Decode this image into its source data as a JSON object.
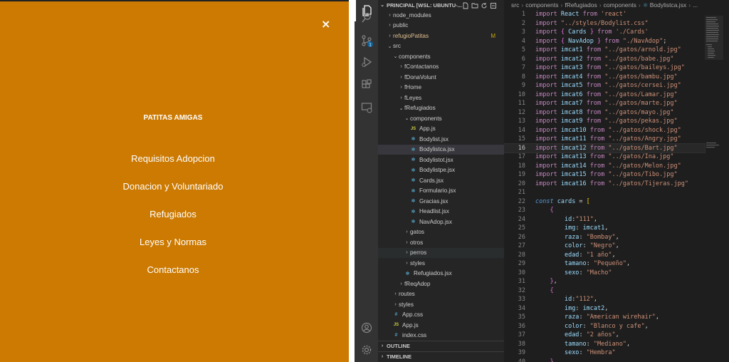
{
  "left_panel": {
    "close_icon": "×",
    "brand": "PATITAS AMIGAS",
    "menu": [
      "Requisitos Adopcion",
      "Donacion y Voluntariado",
      "Refugiados",
      "Leyes y Normas",
      "Contactanos"
    ],
    "background": "#cc7a02"
  },
  "activity_bar": {
    "icons": [
      "files-icon",
      "search-icon",
      "source-control-icon",
      "run-debug-icon",
      "extensions-icon",
      "remote-explorer-icon",
      "account-icon",
      "settings-gear-icon"
    ],
    "source_control_badge": "1"
  },
  "explorer": {
    "title": "PRINCIPAL [WSL: UBUNTU-...",
    "tree": [
      {
        "label": "node_modules",
        "depth": 1,
        "kind": "folder",
        "open": false
      },
      {
        "label": "public",
        "depth": 1,
        "kind": "folder",
        "open": false
      },
      {
        "label": "refugioPatitas",
        "depth": 1,
        "kind": "folder",
        "open": false,
        "git": "M",
        "color": "#e2c08d"
      },
      {
        "label": "src",
        "depth": 1,
        "kind": "folder",
        "open": true
      },
      {
        "label": "components",
        "depth": 2,
        "kind": "folder",
        "open": true
      },
      {
        "label": "fContactanos",
        "depth": 3,
        "kind": "folder",
        "open": false
      },
      {
        "label": "fDonaVolunt",
        "depth": 3,
        "kind": "folder",
        "open": false
      },
      {
        "label": "fHome",
        "depth": 3,
        "kind": "folder",
        "open": false
      },
      {
        "label": "fLeyes",
        "depth": 3,
        "kind": "folder",
        "open": false
      },
      {
        "label": "fRefugiados",
        "depth": 3,
        "kind": "folder",
        "open": true
      },
      {
        "label": "components",
        "depth": 4,
        "kind": "folder",
        "open": true
      },
      {
        "label": "App.js",
        "depth": 5,
        "kind": "js"
      },
      {
        "label": "Bodylist.jsx",
        "depth": 5,
        "kind": "jsx"
      },
      {
        "label": "Bodylistca.jsx",
        "depth": 5,
        "kind": "jsx",
        "selected": true
      },
      {
        "label": "Bodylistot.jsx",
        "depth": 5,
        "kind": "jsx"
      },
      {
        "label": "Bodylistpe.jsx",
        "depth": 5,
        "kind": "jsx"
      },
      {
        "label": "Cards.jsx",
        "depth": 5,
        "kind": "jsx"
      },
      {
        "label": "Formulario.jsx",
        "depth": 5,
        "kind": "jsx"
      },
      {
        "label": "Gracias.jsx",
        "depth": 5,
        "kind": "jsx"
      },
      {
        "label": "Headlist.jsx",
        "depth": 5,
        "kind": "jsx"
      },
      {
        "label": "NavAdop.jsx",
        "depth": 5,
        "kind": "jsx"
      },
      {
        "label": "gatos",
        "depth": 4,
        "kind": "folder",
        "open": false
      },
      {
        "label": "otros",
        "depth": 4,
        "kind": "folder",
        "open": false
      },
      {
        "label": "perros",
        "depth": 4,
        "kind": "folder",
        "open": false,
        "hover": true
      },
      {
        "label": "styles",
        "depth": 4,
        "kind": "folder",
        "open": false
      },
      {
        "label": "Refugiados.jsx",
        "depth": 4,
        "kind": "jsx"
      },
      {
        "label": "fReqAdop",
        "depth": 3,
        "kind": "folder",
        "open": false
      },
      {
        "label": "routes",
        "depth": 2,
        "kind": "folder",
        "open": false
      },
      {
        "label": "styles",
        "depth": 2,
        "kind": "folder",
        "open": false
      },
      {
        "label": "App.css",
        "depth": 2,
        "kind": "css"
      },
      {
        "label": "App.js",
        "depth": 2,
        "kind": "js"
      },
      {
        "label": "index.css",
        "depth": 2,
        "kind": "css"
      }
    ],
    "outline": "OUTLINE",
    "timeline": "TIMELINE"
  },
  "editor": {
    "breadcrumbs": [
      "src",
      "components",
      "fRefugiados",
      "components",
      "Bodylistca.jsx",
      "..."
    ],
    "current_line": 16,
    "lines": [
      "import React from 'react'",
      "import \"../styles/Bodylist.css\"",
      "import { Cards } from './Cards'",
      "import { NavAdop } from \"./NavAdop\";",
      "import imcat1 from \"../gatos/arnold.jpg\"",
      "import imcat2 from \"../gatos/babe.jpg\"",
      "import imcat3 from \"../gatos/baileys.jpg\"",
      "import imcat4 from \"../gatos/bambu.jpg\"",
      "import imcat5 from \"../gatos/cersei.jpg\"",
      "import imcat6 from \"../gatos/Lamar.jpg\"",
      "import imcat7 from \"../gatos/marte.jpg\"",
      "import imcat8 from \"../gatos/mayo.jpg\"",
      "import imcat9 from \"../gatos/pekas.jpg\"",
      "import imcat10 from \"../gatos/shock.jpg\"",
      "import imcat11 from \"../gatos/Angry.jpg\"",
      "import imcat12 from \"../gatos/Bart.jpg\"",
      "import imcat13 from \"../gatos/Ina.jpg\"",
      "import imcat14 from \"../gatos/Melon.jpg\"",
      "import imcat15 from \"../gatos/Tibo.jpg\"",
      "import imcat16 from \"../gatos/Tijeras.jpg\"",
      "",
      "const cards = [",
      "    {",
      "        id:\"111\",",
      "        img: imcat1,",
      "        raza: \"Bombay\",",
      "        color: \"Negro\",",
      "        edad: \"1 año\",",
      "        tamano: \"Pequeño\",",
      "        sexo: \"Macho\"",
      "    },",
      "    {",
      "        id:\"112\",",
      "        img: imcat2,",
      "        raza: \"American wirehair\",",
      "        color: \"Blanco y cafe\",",
      "        edad: \"2 años\",",
      "        tamano: \"Mediano\",",
      "        sexo: \"Hembra\"",
      "    },"
    ]
  }
}
